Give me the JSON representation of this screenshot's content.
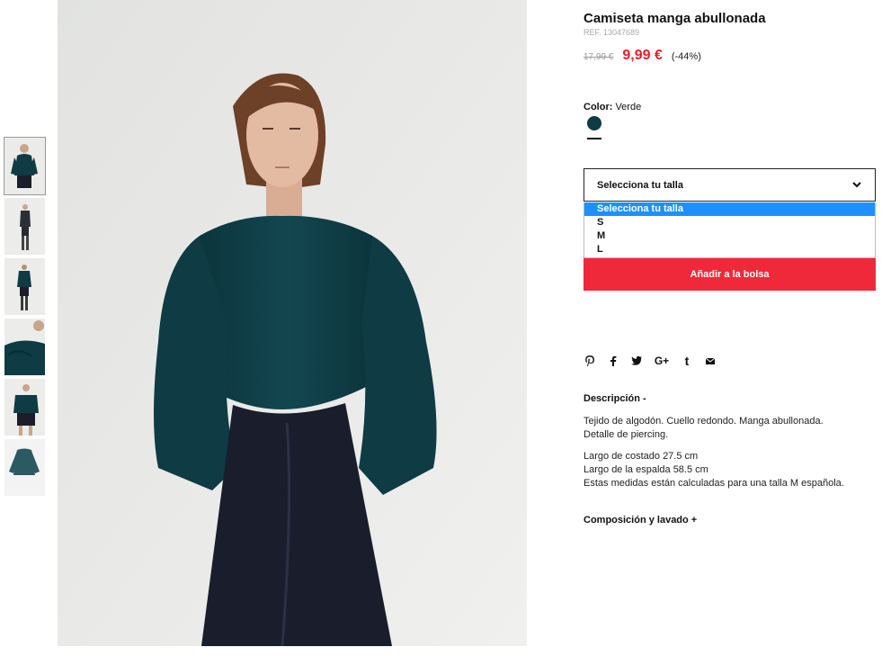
{
  "product": {
    "title": "Camiseta manga abullonada",
    "ref": "REF. 13047689",
    "old_price": "17,99 €",
    "new_price": "9,99 €",
    "discount": "(-44%)"
  },
  "color": {
    "label": "Color:",
    "value": "Verde",
    "swatch_hex": "#0e3b44"
  },
  "size": {
    "select_label": "Selecciona tu talla",
    "options": [
      "Selecciona tu talla",
      "S",
      "M",
      "L"
    ],
    "selected": "Selecciona tu talla"
  },
  "add_button": "Añadir a la bolsa",
  "share_icons": [
    "pinterest-icon",
    "facebook-icon",
    "twitter-icon",
    "google-plus-icon",
    "tumblr-icon",
    "email-icon"
  ],
  "description": {
    "title": "Descripción -",
    "p1_line1": "Tejido de algodón. Cuello redondo. Manga abullonada.",
    "p1_line2": "Detalle de piercing.",
    "p2_line1": "Largo de costado 27.5 cm",
    "p2_line2": "Largo de la espalda 58.5 cm",
    "p2_line3": "Estas medidas están calculadas para una talla M española."
  },
  "composition_title": "Composición y lavado +",
  "colors": {
    "accent_red": "#e4202e",
    "button_red": "#f0293a",
    "select_highlight": "#1e90ff",
    "garment_teal": "#0e3b44"
  }
}
